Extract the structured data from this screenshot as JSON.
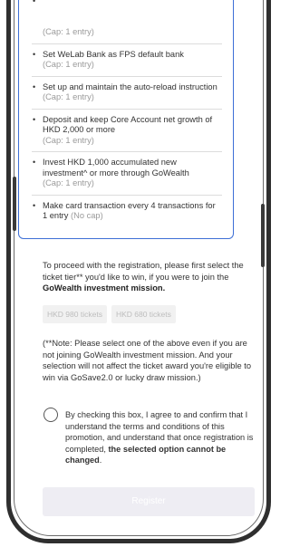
{
  "tasks": [
    {
      "title": "",
      "cap": "(Cap: 1 entry)"
    },
    {
      "title": "Set WeLab Bank as FPS default bank",
      "cap": "(Cap: 1 entry)"
    },
    {
      "title": "Set up and maintain the auto-reload instruction",
      "cap": "(Cap: 1 entry)"
    },
    {
      "title": "Deposit and keep Core Account net growth of HKD 2,000 or more",
      "cap": "(Cap: 1 entry)"
    },
    {
      "title": "Invest HKD 1,000 accumulated new investment^ or more through GoWealth",
      "cap": "(Cap: 1 entry)"
    },
    {
      "title": "Make card transaction every 4 transactions for 1 entry",
      "cap": "(No cap)"
    }
  ],
  "proceed": {
    "text": "To proceed with the registration, please first select the ticket tier** you'd like to win, if you were to join the ",
    "bold": "GoWealth investment mission."
  },
  "tiers": [
    "HKD 980 tickets",
    "HKD 680 tickets"
  ],
  "note": "(**Note: Please select one of the above even if you are not joining GoWealth investment mission. And your selection will not affect the ticket award you're eligible to win via GoSave2.0 or lucky draw mission.)",
  "consent": {
    "text": "By checking this box, I agree to and confirm that I understand the terms and conditions of this promotion, and understand that once registration is completed, ",
    "bold": "the selected option cannot be changed",
    "end": "."
  },
  "register_label": "Register"
}
